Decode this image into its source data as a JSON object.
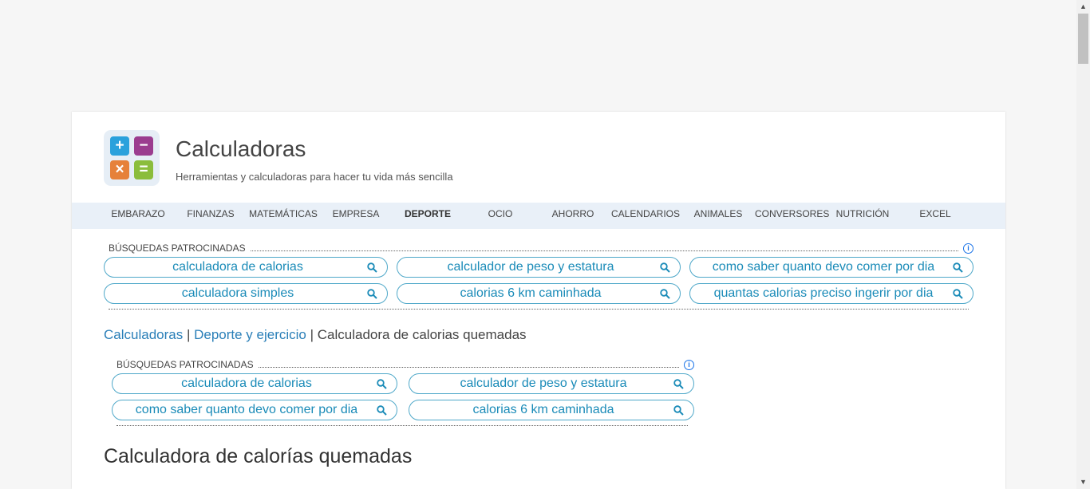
{
  "site": {
    "title": "Calculadoras",
    "subtitle": "Herramientas y calculadoras para hacer tu vida más sencilla"
  },
  "nav": {
    "items": [
      "EMBARAZO",
      "FINANZAS",
      "MATEMÁTICAS",
      "EMPRESA",
      "DEPORTE",
      "OCIO",
      "AHORRO",
      "CALENDARIOS",
      "ANIMALES",
      "CONVERSORES",
      "NUTRICIÓN",
      "EXCEL"
    ],
    "active": "DEPORTE"
  },
  "ads_top": {
    "heading": "BÚSQUEDAS PATROCINADAS",
    "items": [
      "calculadora de calorias",
      "calculador de peso y estatura",
      "como saber quanto devo comer por dia",
      "calculadora simples",
      "calorias 6 km caminhada",
      "quantas calorias preciso ingerir por dia"
    ]
  },
  "breadcrumb": {
    "home": "Calculadoras",
    "section": "Deporte y ejercicio",
    "sep1": " | ",
    "sep2": " | ",
    "current": "Calculadora de calorias quemadas"
  },
  "ads_mid": {
    "heading": "BÚSQUEDAS PATROCINADAS",
    "items": [
      "calculadora de calorias",
      "calculador de peso y estatura",
      "como saber quanto devo comer por dia",
      "calorias 6 km caminhada"
    ]
  },
  "page": {
    "title": "Calculadora de calorías quemadas"
  },
  "colors": {
    "accent": "#1a8bb8",
    "nav_bg": "#e9f0f8",
    "logo_plus": "#2aa1dc",
    "logo_minus": "#9b3d8f",
    "logo_times": "#e6813a",
    "logo_equals": "#8bbd3c"
  }
}
